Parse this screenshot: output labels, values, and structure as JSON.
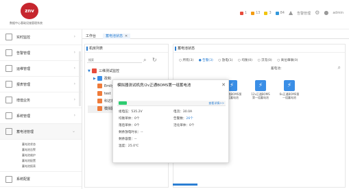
{
  "header": {
    "logo_text": "znv",
    "subtitle": "数据中心基础设施管理系统",
    "stats": [
      {
        "label": "1",
        "color": "#e74c3c"
      },
      {
        "label": "13",
        "color": "#f39c12"
      },
      {
        "label": "3",
        "color": "#f1c40f"
      },
      {
        "label": "84",
        "color": "#3498db"
      }
    ],
    "manage_label": "告警管理",
    "user_label": "admin"
  },
  "sidebar": {
    "items": [
      {
        "label": "实时监控"
      },
      {
        "label": "告警管理"
      },
      {
        "label": "运维管理"
      },
      {
        "label": "报表管理"
      },
      {
        "label": "增值业务"
      },
      {
        "label": "系统管理"
      },
      {
        "label": "蓄电池管理"
      }
    ],
    "submenu": [
      "蓄电池状态",
      "蓄电池告警",
      "蓄电池维护",
      "蓄电池配置",
      "蓄电池报表"
    ],
    "bottom_label": "系统配置"
  },
  "tabs": {
    "home": "工作台",
    "current": "蓄电池状态",
    "close": "✕"
  },
  "left_panel": {
    "title": "机房列表",
    "search_placeholder": "搜索",
    "tree": [
      {
        "label": "三维测试监控"
      },
      {
        "label": "政和"
      },
      {
        "label": "Emily"
      },
      {
        "label": "test"
      },
      {
        "label": "科达机"
      },
      {
        "label": "模拟器"
      }
    ]
  },
  "right_panel": {
    "title": "蓄电池状态",
    "filters": [
      "所有(3)",
      "告警(3)",
      "放电(1)",
      "均衡(0)",
      "浮充(0)",
      "离位串联(0)"
    ],
    "selected_filter": "告警(3)",
    "model_label": "蓄电池：",
    "devices": [
      {
        "label": "2v正通BOMS第一组蓄电池"
      },
      {
        "label": "12v正通BOMS第一组蓄电池"
      },
      {
        "label": "6v正通BOMS第一组蓄电池"
      }
    ]
  },
  "popup": {
    "title": "模拟器测试机房/2v正通BOMS第一组蓄电池",
    "close": "✕",
    "detail_link": "查看详情>>",
    "rows": [
      {
        "l1": "组电压：535.2V",
        "l2": "电流：30.0A"
      },
      {
        "l1": "均衡单体：0个",
        "l2": "告警数：",
        "l2v": "26个"
      },
      {
        "l1": "落后单体：0个",
        "l2": "活化单体：0个"
      },
      {
        "l1": "剩余放电时长：--"
      },
      {
        "l1": "剩余容量：--"
      },
      {
        "l1": "温度：25.0℃"
      }
    ]
  }
}
